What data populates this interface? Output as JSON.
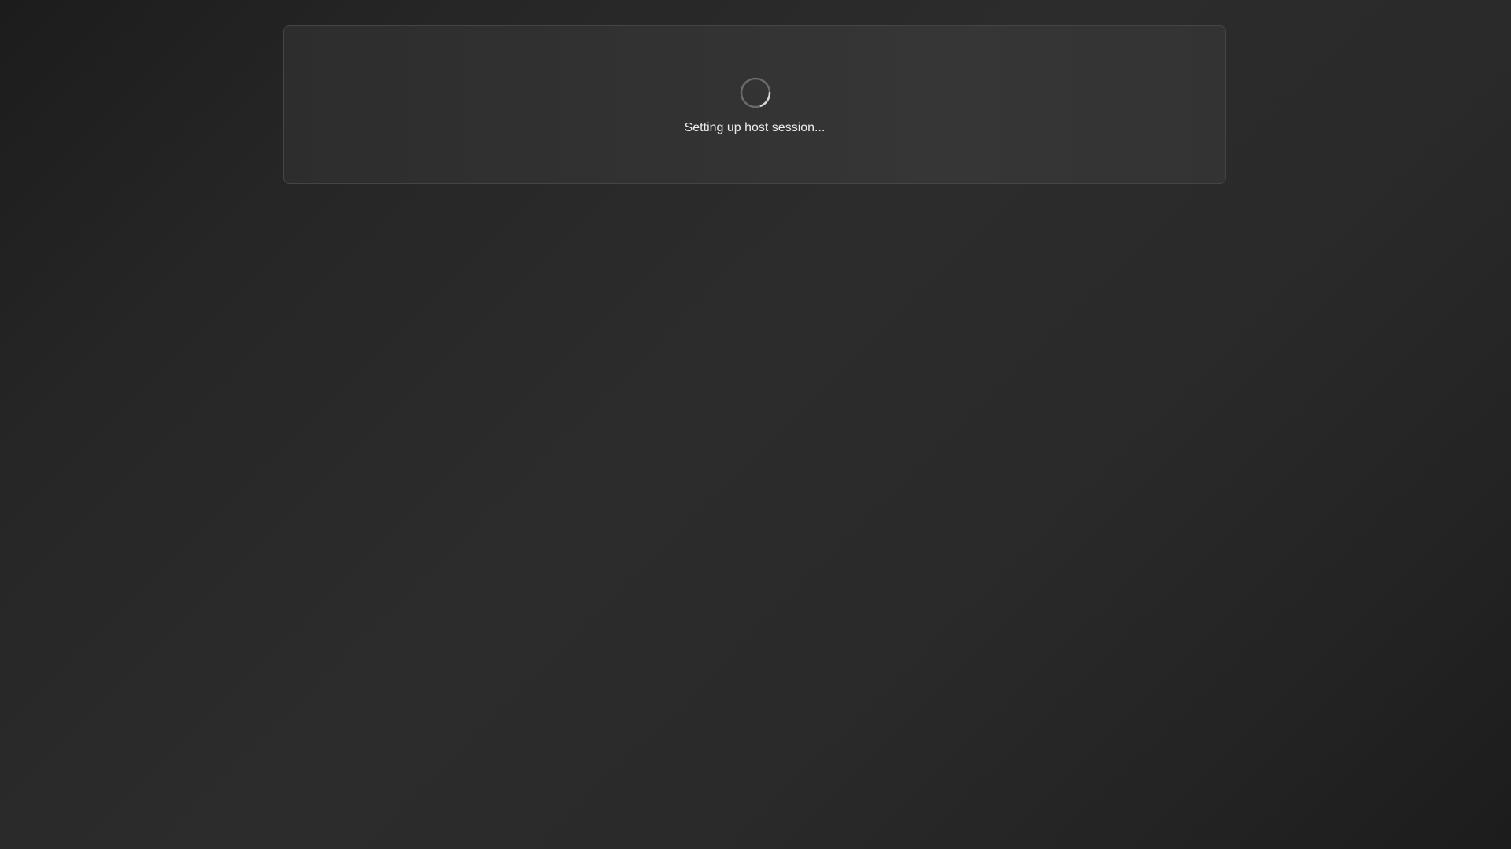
{
  "loading": {
    "status_text": "Setting up host session...",
    "spinner_icon": "spinner-icon"
  },
  "colors": {
    "background": "#2a2a2a",
    "card_background": "#333333",
    "card_border": "#454545",
    "text": "#ececec",
    "spinner_track": "#6a6a6a",
    "spinner_arc": "#d8d8d8"
  }
}
